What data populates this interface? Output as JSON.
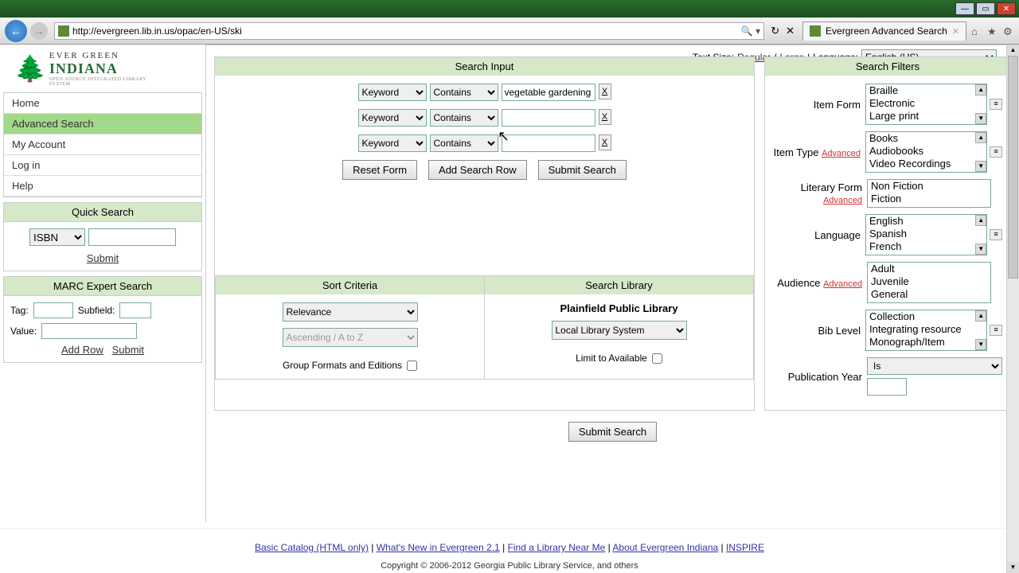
{
  "browser": {
    "url": "http://evergreen.lib.in.us/opac/en-US/ski",
    "tab_title": "Evergreen Advanced Search"
  },
  "header": {
    "textsize_label": "Text Size:",
    "regular": "Regular",
    "large": "Large",
    "language_label": "Language:",
    "language_value": "English (US)"
  },
  "logo": {
    "line1": "EVER GREEN",
    "line2": "INDIANA",
    "line3": "OPEN SOURCE INTEGRATED LIBRARY SYSTEM"
  },
  "nav": {
    "home": "Home",
    "advanced": "Advanced Search",
    "account": "My Account",
    "login": "Log in",
    "help": "Help"
  },
  "quicksearch": {
    "title": "Quick Search",
    "type": "ISBN",
    "submit": "Submit"
  },
  "marc": {
    "title": "MARC Expert Search",
    "tag": "Tag:",
    "subfield": "Subfield:",
    "value": "Value:",
    "addrow": "Add Row",
    "submit": "Submit"
  },
  "search_input": {
    "title": "Search Input",
    "rows": [
      {
        "field": "Keyword",
        "match": "Contains",
        "term": "vegetable gardening"
      },
      {
        "field": "Keyword",
        "match": "Contains",
        "term": ""
      },
      {
        "field": "Keyword",
        "match": "Contains",
        "term": ""
      }
    ],
    "reset": "Reset Form",
    "addrow": "Add Search Row",
    "submit": "Submit Search"
  },
  "sort": {
    "title": "Sort Criteria",
    "by": "Relevance",
    "dir": "Ascending / A to Z",
    "group": "Group Formats and Editions"
  },
  "library": {
    "title": "Search Library",
    "name": "Plainfield Public Library",
    "scope": "Local Library System",
    "limit": "Limit to Available"
  },
  "filters": {
    "title": "Search Filters",
    "advanced": "Advanced",
    "itemform": {
      "label": "Item Form",
      "options": [
        "Braille",
        "Electronic",
        "Large print"
      ]
    },
    "itemtype": {
      "label": "Item Type",
      "options": [
        "Books",
        "Audiobooks",
        "Video Recordings"
      ]
    },
    "litform": {
      "label": "Literary Form",
      "options": [
        "Non Fiction",
        "Fiction"
      ]
    },
    "language": {
      "label": "Language",
      "options": [
        "English",
        "Spanish",
        "French"
      ]
    },
    "audience": {
      "label": "Audience",
      "options": [
        "Adult",
        "Juvenile",
        "General"
      ]
    },
    "biblevel": {
      "label": "Bib Level",
      "options": [
        "Collection",
        "Integrating resource",
        "Monograph/Item"
      ]
    },
    "pubyear": {
      "label": "Publication Year",
      "op": "Is"
    }
  },
  "bottom_submit": "Submit Search",
  "footer": {
    "basic": "Basic Catalog (HTML only)",
    "whatsnew": "What's New in Evergreen 2.1",
    "findlib": "Find a Library Near Me",
    "about": "About Evergreen Indiana",
    "inspire": "INSPIRE",
    "copyright": "Copyright © 2006-2012 Georgia Public Library Service, and others"
  }
}
